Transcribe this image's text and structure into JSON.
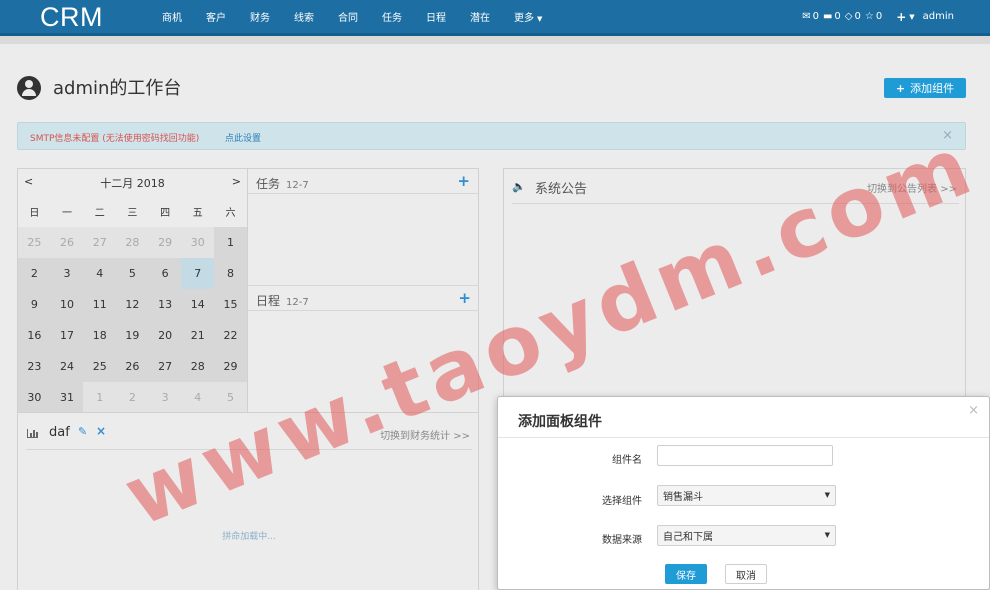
{
  "navbar": {
    "logo": "CRM",
    "menu": [
      {
        "label": "商机"
      },
      {
        "label": "客户"
      },
      {
        "label": "财务"
      },
      {
        "label": "线索"
      },
      {
        "label": "合同"
      },
      {
        "label": "任务"
      },
      {
        "label": "日程"
      },
      {
        "label": "潜在"
      },
      {
        "label": "更多"
      }
    ],
    "counts": {
      "mail": "0",
      "message": "0",
      "tasks": "0",
      "favorites": "0"
    },
    "user": "admin"
  },
  "page": {
    "title": "admin的工作台",
    "add_widget_label": "添加组件"
  },
  "alert": {
    "text": "SMTP信息未配置 (无法使用密码找回功能)",
    "link": "点此设置",
    "close": "×"
  },
  "calendar": {
    "month": "十二月 2018",
    "prev": "<",
    "next": ">",
    "weekdays": [
      "日",
      "一",
      "二",
      "三",
      "四",
      "五",
      "六"
    ],
    "weeks": [
      [
        "25",
        "26",
        "27",
        "28",
        "29",
        "30",
        "1"
      ],
      [
        "2",
        "3",
        "4",
        "5",
        "6",
        "7",
        "8"
      ],
      [
        "9",
        "10",
        "11",
        "12",
        "13",
        "14",
        "15"
      ],
      [
        "16",
        "17",
        "18",
        "19",
        "20",
        "21",
        "22"
      ],
      [
        "23",
        "24",
        "25",
        "26",
        "27",
        "28",
        "29"
      ],
      [
        "30",
        "31",
        "1",
        "2",
        "3",
        "4",
        "5"
      ]
    ],
    "today": "7"
  },
  "task_section": {
    "title": "任务",
    "date": "12-7",
    "add": "+"
  },
  "schedule_section": {
    "title": "日程",
    "date": "12-7",
    "add": "+"
  },
  "announcement": {
    "title": "系统公告",
    "link": "切换到公告列表 >>"
  },
  "finance_widget": {
    "title": "daf",
    "link": "切换到财务统计 >>",
    "loading": "拼命加载中..."
  },
  "modal": {
    "title": "添加面板组件",
    "close": "×",
    "name_label": "组件名",
    "name_value": "",
    "widget_label": "选择组件",
    "widget_value": "销售漏斗",
    "source_label": "数据来源",
    "source_value": "自己和下属",
    "save": "保存",
    "cancel": "取消"
  },
  "watermark": "www.taoydm.com",
  "colors": {
    "navbar": "#1d6fa3",
    "primary_button": "#1f9bd6",
    "alert_bg": "#cfe3ea",
    "alert_text": "#d9534f",
    "watermark": "#e25858"
  }
}
